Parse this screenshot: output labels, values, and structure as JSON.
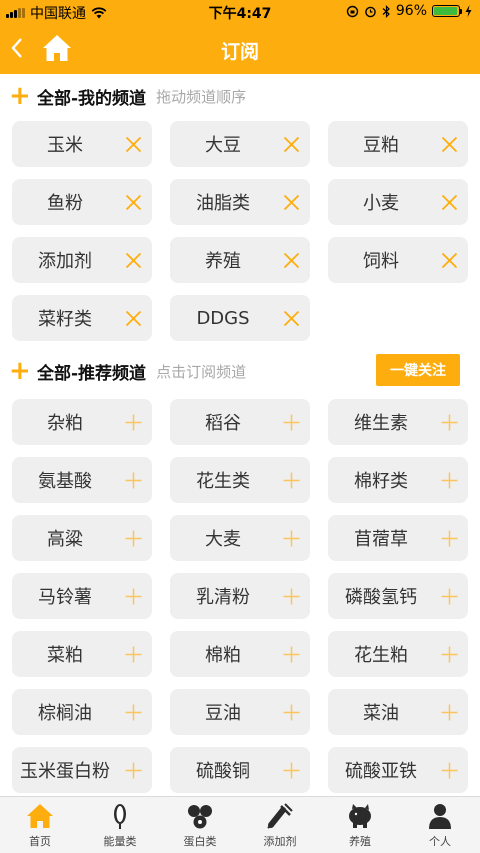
{
  "status": {
    "carrier": "中国联通",
    "time": "下午4:47",
    "battery": "96%",
    "battery_level": 0.96
  },
  "header": {
    "title": "订阅",
    "back_icon": "back-chevron-icon",
    "home_icon": "home-icon"
  },
  "my_channels": {
    "title": "全部-我的频道",
    "hint": "拖动频道顺序",
    "items": [
      "玉米",
      "大豆",
      "豆粕",
      "鱼粉",
      "油脂类",
      "小麦",
      "添加剂",
      "养殖",
      "饲料",
      "菜籽类",
      "DDGS"
    ]
  },
  "recommended": {
    "title": "全部-推荐频道",
    "hint": "点击订阅频道",
    "subscribe_all": "一键关注",
    "items": [
      "杂粕",
      "稻谷",
      "维生素",
      "氨基酸",
      "花生类",
      "棉籽类",
      "高粱",
      "大麦",
      "苜蓿草",
      "马铃薯",
      "乳清粉",
      "磷酸氢钙",
      "菜粕",
      "棉粕",
      "花生粕",
      "棕榈油",
      "豆油",
      "菜油",
      "玉米蛋白粉",
      "硫酸铜",
      "硫酸亚铁"
    ]
  },
  "tabs": [
    {
      "label": "首页",
      "icon": "home-icon",
      "active": true
    },
    {
      "label": "能量类",
      "icon": "corn-icon",
      "active": false
    },
    {
      "label": "蛋白类",
      "icon": "beans-icon",
      "active": false
    },
    {
      "label": "添加剂",
      "icon": "syringe-icon",
      "active": false
    },
    {
      "label": "养殖",
      "icon": "pig-icon",
      "active": false
    },
    {
      "label": "个人",
      "icon": "person-icon",
      "active": false
    }
  ],
  "colors": {
    "accent": "#fdad0d",
    "chip_bg": "#efefef",
    "hint": "#a8a8a8"
  }
}
